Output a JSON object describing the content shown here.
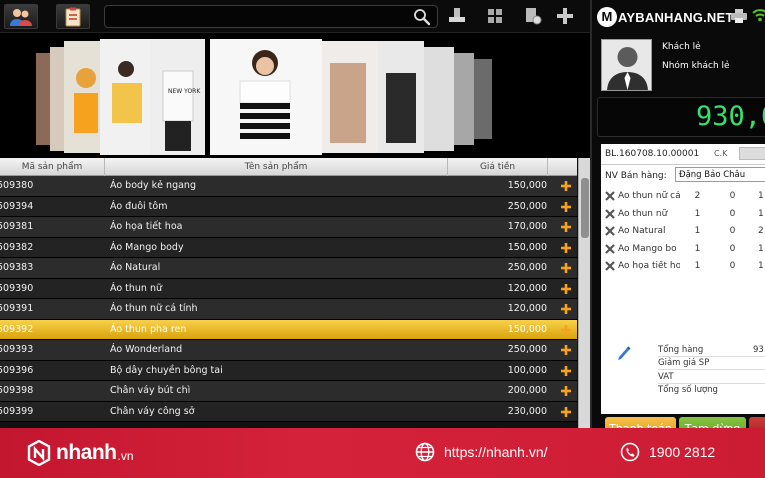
{
  "toolbar": {
    "search": {
      "value": "",
      "placeholder": ""
    }
  },
  "table": {
    "columns": [
      "Mã sản phẩm",
      "Tên sản phẩm",
      "Giá tiền"
    ],
    "rows": [
      {
        "code": "509380",
        "name": "Áo body kẻ ngang",
        "price": "150,000"
      },
      {
        "code": "509394",
        "name": "Áo đuôi tôm",
        "price": "250,000"
      },
      {
        "code": "509381",
        "name": "Áo họa tiết hoa",
        "price": "170,000"
      },
      {
        "code": "509382",
        "name": "Áo Mango body",
        "price": "150,000"
      },
      {
        "code": "509383",
        "name": "Áo Natural",
        "price": "250,000"
      },
      {
        "code": "509390",
        "name": "Áo thun nữ",
        "price": "120,000"
      },
      {
        "code": "509391",
        "name": "Áo thun nữ cá tính",
        "price": "120,000"
      },
      {
        "code": "509392",
        "name": "Áo thun pha ren",
        "price": "150,000",
        "selected": true
      },
      {
        "code": "509393",
        "name": "Áo Wonderland",
        "price": "250,000"
      },
      {
        "code": "509396",
        "name": "Bộ dây chuyền bông tai",
        "price": "100,000"
      },
      {
        "code": "509398",
        "name": "Chân váy bút chì",
        "price": "200,000"
      },
      {
        "code": "509399",
        "name": "Chân váy công sở",
        "price": "230,000"
      }
    ],
    "add_icon": "plus-icon",
    "accent_color": "#f7a21b",
    "selected_color": "#e9b620"
  },
  "right": {
    "logo": "AYBANHANG.NET",
    "logo_badge": "M",
    "customer": {
      "name": "Khách lẻ",
      "group": "Nhóm khách lẻ"
    },
    "total": "930,0",
    "total_color": "#35e06b",
    "order": {
      "bill_code": "BL.160708.10.00001",
      "ck_label": "C.K",
      "seller_label": "NV Bán hàng:",
      "seller_value": "Đặng Bảo Châu",
      "items": [
        {
          "name": "Áo thun nữ cá",
          "qty": "2",
          "discount": "0",
          "extra": "1"
        },
        {
          "name": "Áo thun nữ",
          "qty": "1",
          "discount": "0",
          "extra": "1"
        },
        {
          "name": "Áo Natural",
          "qty": "1",
          "discount": "0",
          "extra": "2"
        },
        {
          "name": "Áo Mango bo",
          "qty": "1",
          "discount": "0",
          "extra": "1"
        },
        {
          "name": "Áo họa tiết ho",
          "qty": "1",
          "discount": "0",
          "extra": "1"
        }
      ],
      "summary": {
        "total_goods_label": "Tổng hàng",
        "total_goods_value": "93",
        "discount_label": "Giảm giá SP",
        "vat_label": "VAT",
        "qty_label": "Tổng số lượng"
      }
    },
    "buttons": {
      "pay": "Thanh toán",
      "hold": "Tạm dừng"
    }
  },
  "footer": {
    "brand": "nhanh",
    "brand_tld": ".vn",
    "website": "https://nhanh.vn/",
    "phone": "1900 2812",
    "color": "#c8192f"
  }
}
